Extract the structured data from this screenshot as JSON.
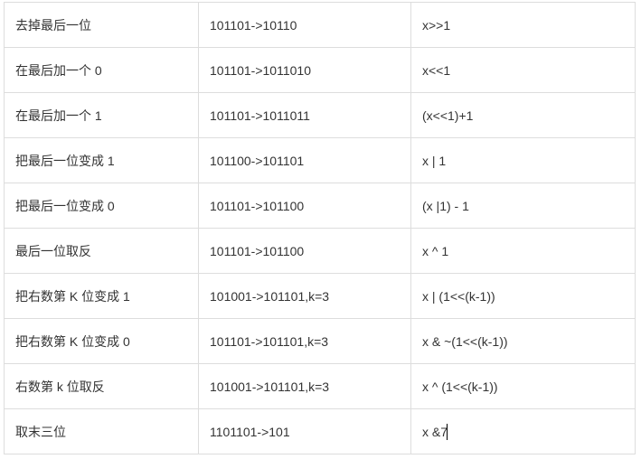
{
  "rows": [
    {
      "desc": "去掉最后一位",
      "example": "101101->10110",
      "expr": "x>>1"
    },
    {
      "desc": "在最后加一个 0",
      "example": "101101->1011010",
      "expr": "x<<1"
    },
    {
      "desc": "在最后加一个 1",
      "example": "101101->1011011",
      "expr": "(x<<1)+1"
    },
    {
      "desc": "把最后一位变成 1",
      "example": "101100->101101",
      "expr": "x | 1"
    },
    {
      "desc": "把最后一位变成 0",
      "example": "101101->101100",
      "expr": "(x |1) - 1"
    },
    {
      "desc": "最后一位取反",
      "example": "101101->101100",
      "expr": "x ^ 1"
    },
    {
      "desc": "把右数第 K 位变成 1",
      "example": "101001->101101,k=3",
      "expr": "x  | (1<<(k-1))"
    },
    {
      "desc": "把右数第 K 位变成 0",
      "example": "101101->101101,k=3",
      "expr": "x & ~(1<<(k-1))"
    },
    {
      "desc": "右数第 k 位取反",
      "example": "101001->101101,k=3",
      "expr": "x ^ (1<<(k-1))"
    },
    {
      "desc": "取末三位",
      "example": "1101101->101",
      "expr": "x &7"
    }
  ]
}
